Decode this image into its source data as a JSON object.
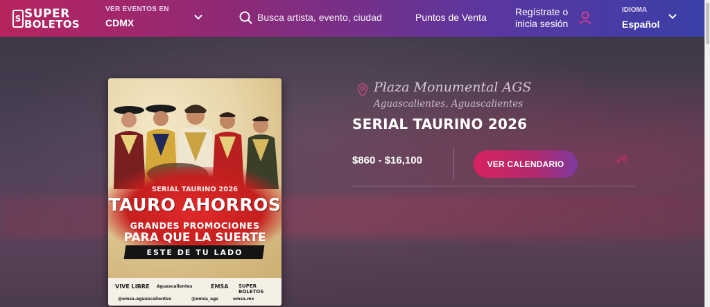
{
  "header": {
    "logo": {
      "top": "SUPER",
      "bottom": "BOLETOS",
      "badge": "S"
    },
    "location": {
      "label": "VER EVENTOS EN",
      "value": "CDMX"
    },
    "search": {
      "placeholder": "Busca artista, evento, ciudad"
    },
    "nav": {
      "points_of_sale": "Puntos de Venta"
    },
    "auth": {
      "line1": "Regístrate o",
      "line2": "inicia sesión"
    },
    "language": {
      "label": "IDIOMA",
      "value": "Español"
    }
  },
  "event": {
    "venue": "Plaza Monumental AGS",
    "city": "Aguascalientes, Aguascalientes",
    "title": "SERIAL TAURINO 2026",
    "price_range": "$860 - $16,100",
    "cta_label": "VER CALENDARIO"
  },
  "poster": {
    "kicker": "SERIAL TAURINO 2026",
    "headline": "TAURO AHORROS",
    "line1": "GRANDES PROMOCIONES",
    "line2": "PARA QUE LA SUERTE",
    "line3": "ESTE DE TU LADO",
    "footer_logos": [
      "VIVE LIBRE",
      "Aguascalientes",
      "EMSA",
      "SUPER BOLETOS"
    ],
    "footer_handles": [
      "@emsa.aguascalientes",
      "@emsa_ags",
      "emsa.mx"
    ]
  },
  "colors": {
    "header_start": "#b7245f",
    "header_end": "#3a3fa8",
    "cta_start": "#d8225f",
    "cta_end": "#7e3aa0",
    "poster_red": "#c51f1f"
  },
  "icons": {
    "search": "search-icon",
    "user": "user-icon",
    "location": "location-pin-icon",
    "share": "share-icon",
    "chevron": "chevron-down-icon"
  }
}
